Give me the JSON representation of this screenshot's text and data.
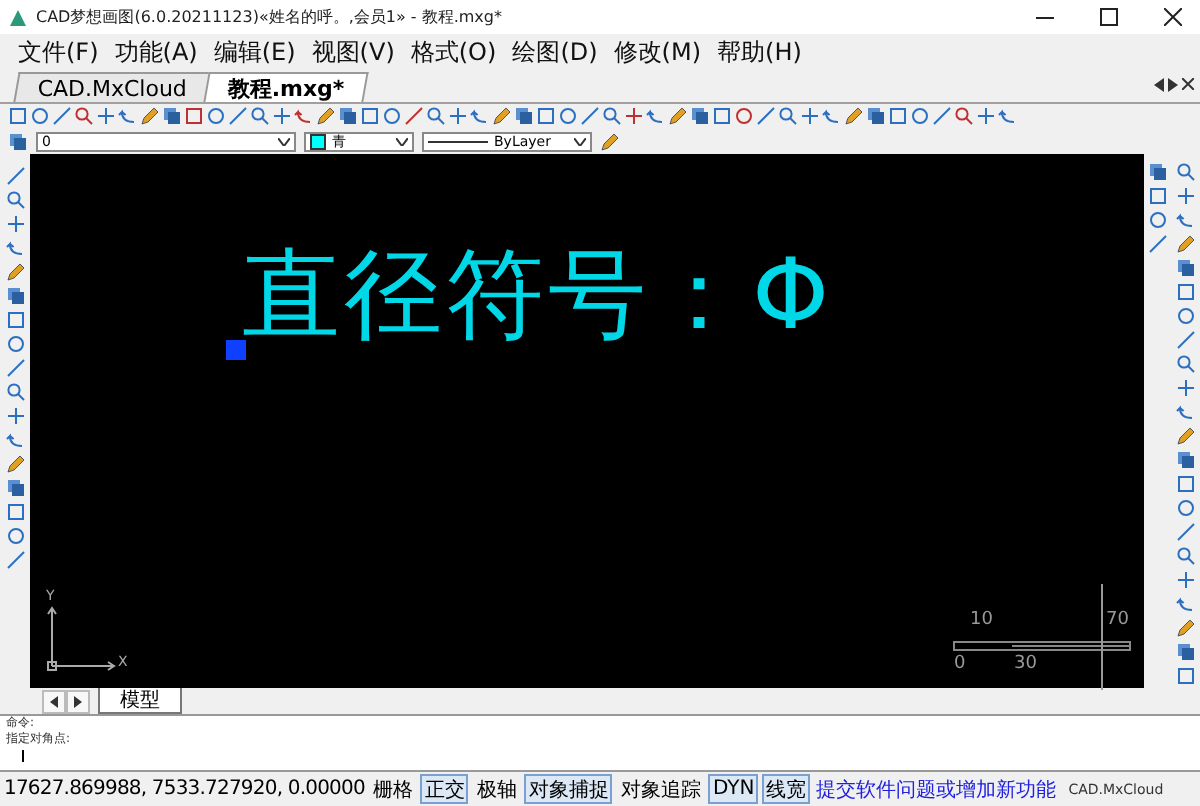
{
  "window": {
    "title": "CAD梦想画图(6.0.20211123)«姓名的呼。,会员1» - 教程.mxg*"
  },
  "menu": [
    "文件(F)",
    "功能(A)",
    "编辑(E)",
    "视图(V)",
    "格式(O)",
    "绘图(D)",
    "修改(M)",
    "帮助(H)"
  ],
  "doc_tabs": [
    {
      "label": "CAD.MxCloud",
      "selected": false
    },
    {
      "label": "教程.mxg*",
      "selected": true
    }
  ],
  "properties": {
    "layer": "0",
    "color": {
      "label": "青",
      "color": "#00ffff"
    },
    "linetype": "ByLayer"
  },
  "canvas": {
    "text": "直径符号：Φ",
    "axis_x": "X",
    "axis_y": "Y",
    "scale_labels": [
      "10",
      "70",
      "0",
      "30"
    ]
  },
  "layout_tabs": [
    {
      "label": "模型",
      "selected": true
    }
  ],
  "command_lines": [
    "命令:",
    "指定对角点:"
  ],
  "status_bar": {
    "coordinates": "17627.869988,  7533.727920,  0.00000",
    "toggles": [
      {
        "label": "栅格",
        "on": false
      },
      {
        "label": "正交",
        "on": true
      },
      {
        "label": "极轴",
        "on": false
      },
      {
        "label": "对象捕捉",
        "on": true
      },
      {
        "label": "对象追踪",
        "on": false
      },
      {
        "label": "DYN",
        "on": true
      },
      {
        "label": "线宽",
        "on": true
      }
    ],
    "link": "提交软件问题或增加新功能",
    "brand": "CAD.MxCloud"
  }
}
